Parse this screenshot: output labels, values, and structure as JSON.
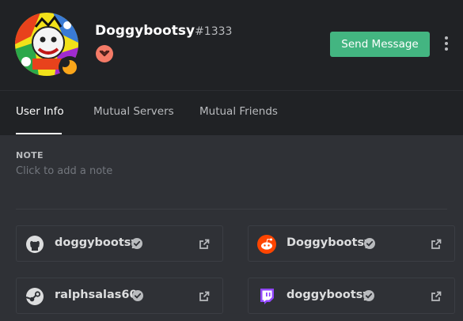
{
  "profile": {
    "username": "Doggybootsy",
    "discriminator": "#1333",
    "status": "idle",
    "badge_icon": "hypesquad-brilliance-chevron-icon",
    "badge_color": "#f47b67"
  },
  "actions": {
    "send_message_label": "Send Message",
    "send_message_color": "#43b581"
  },
  "tabs": [
    {
      "label": "User Info",
      "active": true
    },
    {
      "label": "Mutual Servers",
      "active": false
    },
    {
      "label": "Mutual Friends",
      "active": false
    }
  ],
  "note": {
    "label": "NOTE",
    "placeholder": "Click to add a note"
  },
  "connections": [
    {
      "service": "github",
      "icon": "github-icon",
      "name": "doggybootsy",
      "verified": true
    },
    {
      "service": "reddit",
      "icon": "reddit-icon",
      "name": "Doggybootsy",
      "verified": true,
      "color": "#ff4500"
    },
    {
      "service": "steam",
      "icon": "steam-icon",
      "name": "ralphsalas60",
      "verified": true
    },
    {
      "service": "twitch",
      "icon": "twitch-icon",
      "name": "doggybootsy",
      "verified": true,
      "color": "#9146ff"
    }
  ]
}
